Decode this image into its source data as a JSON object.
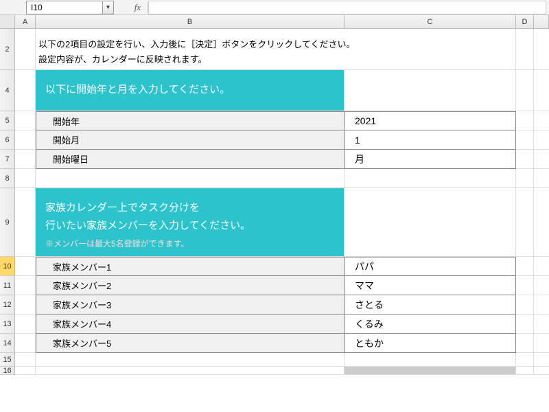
{
  "namebox": "I10",
  "fx_label": "fx",
  "columns": [
    "A",
    "B",
    "C",
    "D",
    ""
  ],
  "rows": [
    "2",
    "4",
    "5",
    "6",
    "7",
    "8",
    "9",
    "10",
    "11",
    "12",
    "13",
    "14",
    "15",
    "16"
  ],
  "active_row": "10",
  "instruction_line1": "以下の2項目の設定を行い、入力後に［決定］ボタンをクリックしてください。",
  "instruction_line2": "設定内容が、カレンダーに反映されます。",
  "section1_title": "以下に開始年と月を入力してください。",
  "section2_line1": "家族カレンダー上でタスク分けを",
  "section2_line2": "行いたい家族メンバーを入力してください。",
  "section2_note": "※メンバーは最大5名登録ができます。",
  "fields1": [
    {
      "label": "開始年",
      "value": "2021"
    },
    {
      "label": "開始月",
      "value": "1"
    },
    {
      "label": "開始曜日",
      "value": "月"
    }
  ],
  "fields2": [
    {
      "label": "家族メンバー1",
      "value": "パパ"
    },
    {
      "label": "家族メンバー2",
      "value": "ママ"
    },
    {
      "label": "家族メンバー3",
      "value": "さとる"
    },
    {
      "label": "家族メンバー4",
      "value": "くるみ"
    },
    {
      "label": "家族メンバー5",
      "value": "ともか"
    }
  ]
}
